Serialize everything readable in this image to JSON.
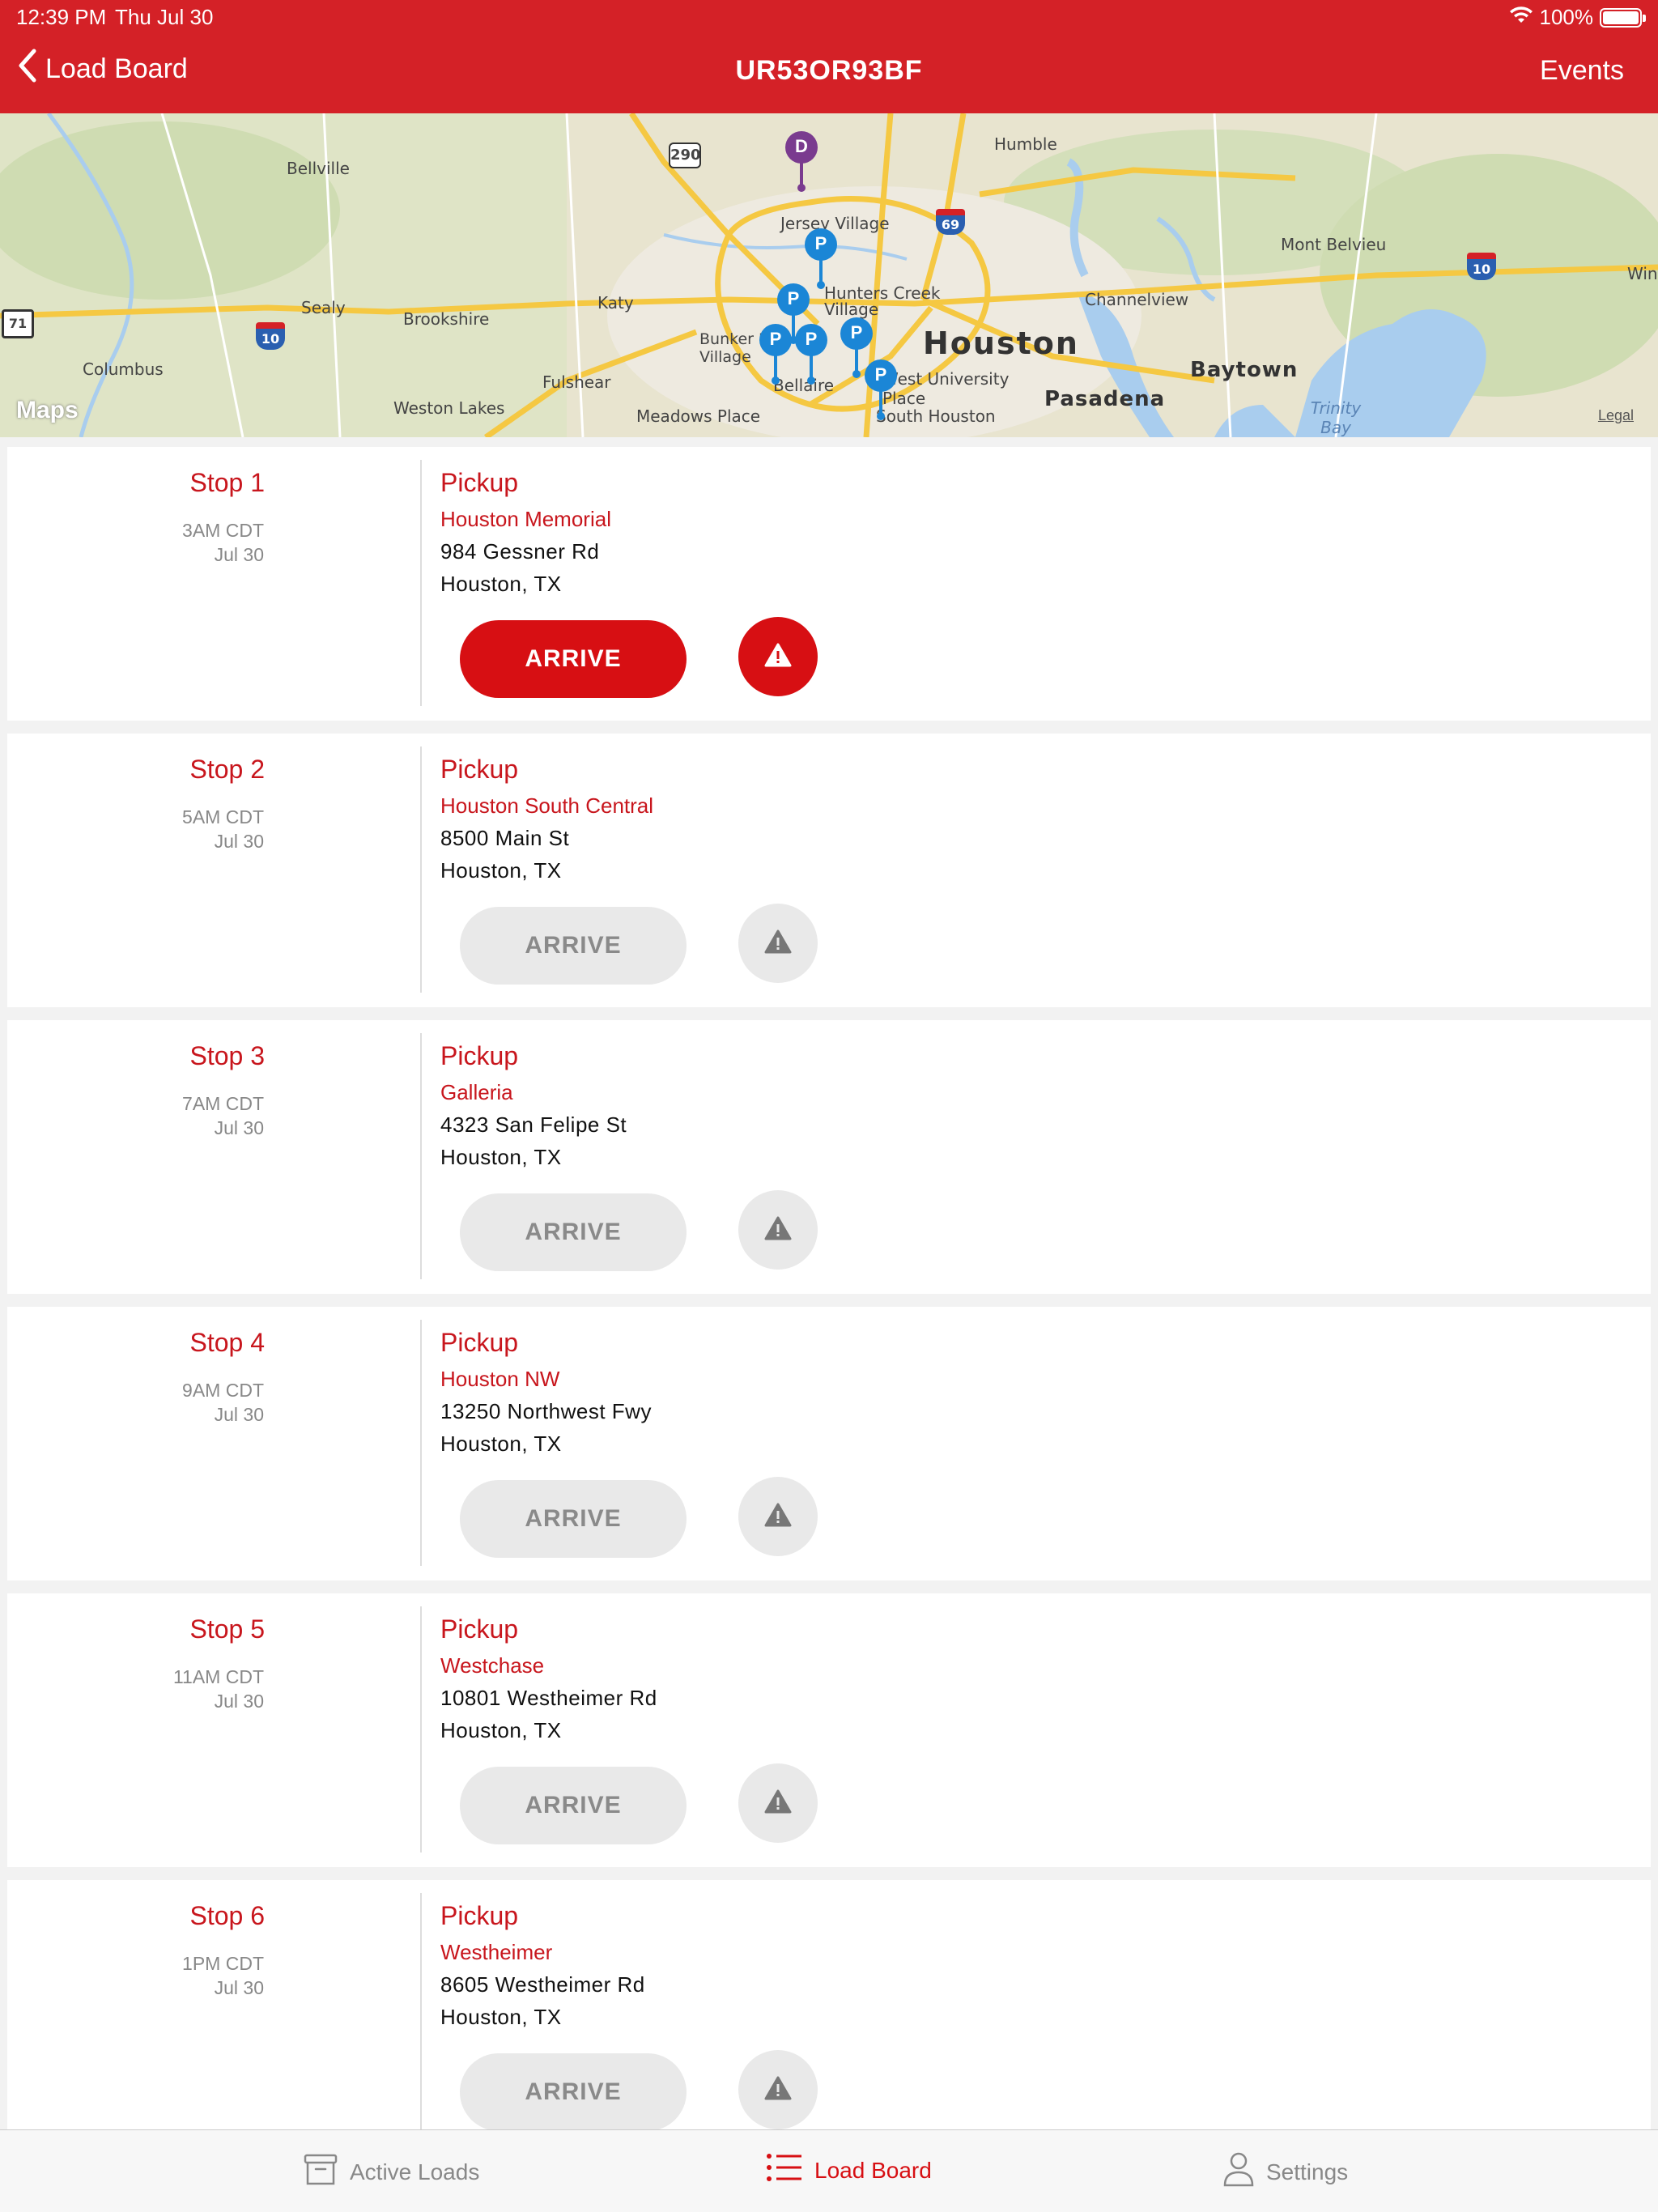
{
  "status_bar": {
    "time": "12:39 PM",
    "date": "Thu Jul 30",
    "battery": "100%",
    "wifi_icon": "wifi-icon",
    "battery_icon": "battery-icon"
  },
  "header": {
    "back_label": "Load Board",
    "title": "UR53OR93BF",
    "events_label": "Events"
  },
  "map": {
    "cities": {
      "houston": "Houston",
      "bellville": "Bellville",
      "humble": "Humble",
      "jersey_village": "Jersey Village",
      "mont_belvieu": "Mont Belvieu",
      "sealy": "Sealy",
      "katy": "Katy",
      "brookshire": "Brookshire",
      "hunters_creek": "Hunters Creek",
      "village": "Village",
      "channelview": "Channelview",
      "bunker_hill": "Bunker Hill Village",
      "bellaire": "Bellaire",
      "west_university": "West University Place",
      "baytown": "Baytown",
      "columbus": "Columbus",
      "fulshear": "Fulshear",
      "pasadena": "Pasadena",
      "weston_lakes": "Weston Lakes",
      "meadows_place": "Meadows Place",
      "south_houston": "South Houston",
      "trinity_bay": "Trinity Bay",
      "winnie": "Win"
    },
    "shields": {
      "us290": "290",
      "i69": "69",
      "i10_west": "10",
      "i10_east": "10",
      "tx71": "71"
    },
    "pin_pickup": "P",
    "pin_delivery": "D",
    "maps_logo": "Maps",
    "legal": "Legal"
  },
  "stops": [
    {
      "name": "Stop 1",
      "time": "3AM CDT",
      "date": "Jul 30",
      "type": "Pickup",
      "location": "Houston Memorial",
      "street": "984 Gessner Rd",
      "city": "Houston, TX",
      "arrive_label": "ARRIVE",
      "active": true
    },
    {
      "name": "Stop 2",
      "time": "5AM CDT",
      "date": "Jul 30",
      "type": "Pickup",
      "location": "Houston South Central",
      "street": "8500 Main St",
      "city": "Houston, TX",
      "arrive_label": "ARRIVE",
      "active": false
    },
    {
      "name": "Stop 3",
      "time": "7AM CDT",
      "date": "Jul 30",
      "type": "Pickup",
      "location": "Galleria",
      "street": "4323 San Felipe St",
      "city": "Houston, TX",
      "arrive_label": "ARRIVE",
      "active": false
    },
    {
      "name": "Stop 4",
      "time": "9AM CDT",
      "date": "Jul 30",
      "type": "Pickup",
      "location": "Houston NW",
      "street": "13250 Northwest Fwy",
      "city": "Houston, TX",
      "arrive_label": "ARRIVE",
      "active": false
    },
    {
      "name": "Stop 5",
      "time": "11AM CDT",
      "date": "Jul 30",
      "type": "Pickup",
      "location": "Westchase",
      "street": "10801 Westheimer Rd",
      "city": "Houston, TX",
      "arrive_label": "ARRIVE",
      "active": false
    },
    {
      "name": "Stop 6",
      "time": "1PM CDT",
      "date": "Jul 30",
      "type": "Pickup",
      "location": "Westheimer",
      "street": "8605 Westheimer Rd",
      "city": "Houston, TX",
      "arrive_label": "ARRIVE",
      "active": false
    }
  ],
  "tabbar": {
    "active_loads": "Active Loads",
    "load_board": "Load Board",
    "settings": "Settings"
  },
  "colors": {
    "brand_red": "#d42127",
    "button_red": "#d70f13",
    "inactive_gray": "#e9e9e9",
    "pin_blue": "#1b86d6",
    "pin_purple": "#7a3b8f"
  }
}
